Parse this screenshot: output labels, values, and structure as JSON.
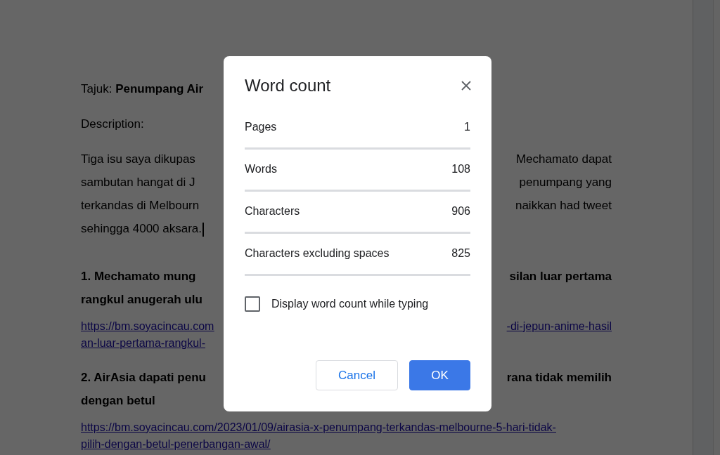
{
  "document": {
    "paragraphs": [
      {
        "kind": "text",
        "lines": [
          {
            "left": "Tajuk: **Penumpang Air**"
          }
        ]
      },
      {
        "kind": "text",
        "lines": [
          {
            "left": "Description:"
          }
        ]
      },
      {
        "kind": "text",
        "cursor": true,
        "lines": [
          {
            "left": "Tiga isu saya dikupas",
            "right": "Mechamato dapat"
          },
          {
            "left": "sambutan hangat di J",
            "right": "penumpang yang"
          },
          {
            "left": "terkandas di Melbourn",
            "right": "naikkan had tweet"
          },
          {
            "left": "sehingga 4000 aksara."
          }
        ]
      },
      {
        "kind": "heading",
        "lines": [
          {
            "left": "1. **Mechamato mung**",
            "right": "silan luar pertama"
          },
          {
            "left": "rangkul anugerah ulu"
          }
        ]
      },
      {
        "kind": "link",
        "lines": [
          {
            "left": "https://bm.soyacincau.com",
            "right": "-di-jepun-anime-hasil"
          },
          {
            "left": "an-luar-pertama-rangkul-"
          }
        ]
      },
      {
        "kind": "heading",
        "lines": [
          {
            "left": "2. AirAsia dapati penu",
            "right": "rana tidak memilih"
          },
          {
            "left": "dengan betul"
          }
        ]
      },
      {
        "kind": "link",
        "lines": [
          {
            "left": "https://bm.soyacincau.com/2023/01/09/airasia-x-penumpang-terkandas-melbourne-5-hari-tidak-"
          },
          {
            "left": "pilih-dengan-betul-penerbangan-awal/"
          }
        ]
      }
    ]
  },
  "dialog": {
    "title": "Word count",
    "stats": [
      {
        "label": "Pages",
        "value": "1"
      },
      {
        "label": "Words",
        "value": "108"
      },
      {
        "label": "Characters",
        "value": "906"
      },
      {
        "label": "Characters excluding spaces",
        "value": "825"
      }
    ],
    "option": {
      "label": "Display word count while typing",
      "checked": false
    },
    "buttons": [
      {
        "label": "Cancel",
        "kind": "secondary"
      },
      {
        "label": "OK",
        "kind": "primary"
      }
    ]
  }
}
